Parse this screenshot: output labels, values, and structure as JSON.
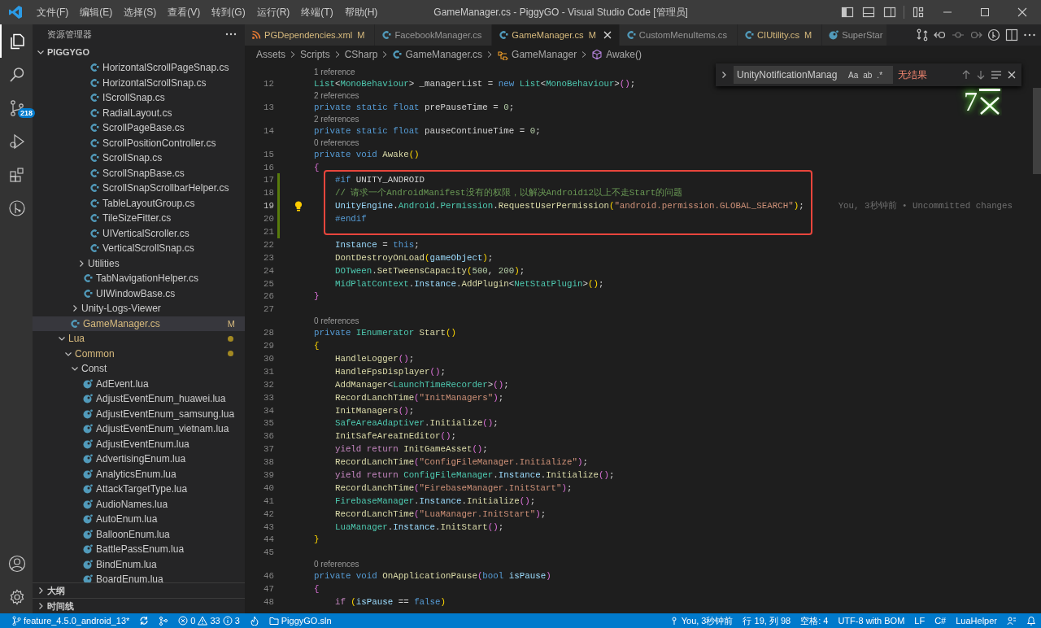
{
  "title_bar": {
    "menus": [
      "文件(F)",
      "编辑(E)",
      "选择(S)",
      "查看(V)",
      "转到(G)",
      "运行(R)",
      "终端(T)",
      "帮助(H)"
    ],
    "title": "GameManager.cs - PiggyGO - Visual Studio Code [管理员]"
  },
  "activity_bar": {
    "items": [
      {
        "kind": "files",
        "selected": true
      },
      {
        "kind": "search",
        "selected": false
      },
      {
        "kind": "scm",
        "selected": false,
        "badge": "218"
      },
      {
        "kind": "debug",
        "selected": false
      },
      {
        "kind": "extensions",
        "selected": false
      },
      {
        "kind": "graph",
        "selected": false
      }
    ],
    "bottom": [
      {
        "kind": "account"
      },
      {
        "kind": "settings"
      }
    ]
  },
  "sidebar": {
    "title": "资源管理器",
    "root": {
      "label": "PIGGYGO",
      "expanded": true
    },
    "items": [
      {
        "children": [
          {
            "children": [
              {
                "children": [
                  {
                    "children": [
                      {
                        "label": "HorizontalScrollPageSnap.cs",
                        "kind": "cs",
                        "selected": false,
                        "modified": false
                      },
                      {
                        "label": "HorizontalScrollSnap.cs",
                        "kind": "cs",
                        "selected": false,
                        "modified": false
                      },
                      {
                        "label": "IScrollSnap.cs",
                        "kind": "cs",
                        "selected": false,
                        "modified": false
                      },
                      {
                        "label": "RadialLayout.cs",
                        "kind": "cs",
                        "selected": false,
                        "modified": false
                      },
                      {
                        "label": "ScrollPageBase.cs",
                        "kind": "cs",
                        "selected": false,
                        "modified": false
                      },
                      {
                        "label": "ScrollPositionController.cs",
                        "kind": "cs",
                        "selected": false,
                        "modified": false
                      },
                      {
                        "label": "ScrollSnap.cs",
                        "kind": "cs",
                        "selected": false,
                        "modified": false
                      },
                      {
                        "label": "ScrollSnapBase.cs",
                        "kind": "cs",
                        "selected": false,
                        "modified": false
                      },
                      {
                        "label": "ScrollSnapScrollbarHelper.cs",
                        "kind": "cs",
                        "selected": false,
                        "modified": false
                      },
                      {
                        "label": "TableLayoutGroup.cs",
                        "kind": "cs",
                        "selected": false,
                        "modified": false
                      },
                      {
                        "label": "TileSizeFitter.cs",
                        "kind": "cs",
                        "selected": false,
                        "modified": false
                      },
                      {
                        "label": "UIVerticalScroller.cs",
                        "kind": "cs",
                        "selected": false,
                        "modified": false
                      },
                      {
                        "label": "VerticalScrollSnap.cs",
                        "kind": "cs",
                        "selected": false,
                        "modified": false
                      }
                    ]
                  },
                  {
                    "label": "Utilities",
                    "kind": "folder",
                    "expanded": false,
                    "selected": false,
                    "modified": false
                  },
                  {
                    "label": "TabNavigationHelper.cs",
                    "kind": "cs",
                    "selected": false,
                    "modified": false
                  },
                  {
                    "label": "UIWindowBase.cs",
                    "kind": "cs",
                    "selected": false,
                    "modified": false
                  }
                ]
              },
              {
                "label": "Unity-Logs-Viewer",
                "kind": "folder",
                "expanded": false,
                "selected": false,
                "modified": false
              }
            ]
          },
          {
            "label": "GameManager.cs",
            "kind": "cs",
            "selected": true,
            "modified": true,
            "badge": "M"
          }
        ]
      },
      {
        "label": "Lua",
        "kind": "folder",
        "expanded": true,
        "selected": false,
        "modified": true,
        "children": [
          {
            "label": "Common",
            "kind": "folder",
            "expanded": true,
            "selected": false,
            "modified": true,
            "children": [
              {
                "label": "Const",
                "kind": "folder",
                "expanded": true,
                "selected": false,
                "modified": false,
                "children": [
                  {
                    "label": "AdEvent.lua",
                    "kind": "lua",
                    "selected": false,
                    "modified": false
                  },
                  {
                    "label": "AdjustEventEnum_huawei.lua",
                    "kind": "lua",
                    "selected": false,
                    "modified": false
                  },
                  {
                    "label": "AdjustEventEnum_samsung.lua",
                    "kind": "lua",
                    "selected": false,
                    "modified": false
                  },
                  {
                    "label": "AdjustEventEnum_vietnam.lua",
                    "kind": "lua",
                    "selected": false,
                    "modified": false
                  },
                  {
                    "label": "AdjustEventEnum.lua",
                    "kind": "lua",
                    "selected": false,
                    "modified": false
                  },
                  {
                    "label": "AdvertisingEnum.lua",
                    "kind": "lua",
                    "selected": false,
                    "modified": false
                  },
                  {
                    "label": "AnalyticsEnum.lua",
                    "kind": "lua",
                    "selected": false,
                    "modified": false
                  },
                  {
                    "label": "AttackTargetType.lua",
                    "kind": "lua",
                    "selected": false,
                    "modified": false
                  },
                  {
                    "label": "AudioNames.lua",
                    "kind": "lua",
                    "selected": false,
                    "modified": false
                  },
                  {
                    "label": "AutoEnum.lua",
                    "kind": "lua",
                    "selected": false,
                    "modified": false
                  },
                  {
                    "label": "BalloonEnum.lua",
                    "kind": "lua",
                    "selected": false,
                    "modified": false
                  },
                  {
                    "label": "BattlePassEnum.lua",
                    "kind": "lua",
                    "selected": false,
                    "modified": false
                  },
                  {
                    "label": "BindEnum.lua",
                    "kind": "lua",
                    "selected": false,
                    "modified": false
                  },
                  {
                    "label": "BoardEnum.lua",
                    "kind": "lua",
                    "selected": false,
                    "modified": false
                  }
                ]
              }
            ]
          }
        ]
      }
    ],
    "sections": [
      {
        "label": "大纲",
        "expanded": false
      },
      {
        "label": "时间线",
        "expanded": false
      }
    ]
  },
  "tabs": [
    {
      "label": "PGDependencies.xml",
      "kind": "xml",
      "modified": true,
      "badge": "M",
      "selected": false
    },
    {
      "label": "FacebookManager.cs",
      "kind": "cs",
      "modified": false,
      "selected": false
    },
    {
      "label": "GameManager.cs",
      "kind": "cs",
      "modified": true,
      "badge": "M",
      "selected": true
    },
    {
      "label": "CustomMenuItems.cs",
      "kind": "cs",
      "modified": false,
      "selected": false
    },
    {
      "label": "CIUtility.cs",
      "kind": "cs",
      "modified": true,
      "badge": "M",
      "selected": false
    },
    {
      "label": "SuperStar",
      "kind": "lua",
      "modified": false,
      "selected": false
    }
  ],
  "breadcrumbs": [
    {
      "label": "Assets",
      "kind": "folder"
    },
    {
      "label": "Scripts",
      "kind": "folder"
    },
    {
      "label": "CSharp",
      "kind": "folder"
    },
    {
      "label": "GameManager.cs",
      "kind": "cs"
    },
    {
      "label": "GameManager",
      "kind": "class"
    },
    {
      "label": "Awake()",
      "kind": "method"
    }
  ],
  "find": {
    "value": "UnityNotificationManag",
    "options": [
      {
        "label": "Aa",
        "on": false
      },
      {
        "label": "ab",
        "on": false
      },
      {
        "label": ".*",
        "on": false
      }
    ],
    "result": "无结果"
  },
  "overlay": {
    "text": "7"
  },
  "code": {
    "lines": [
      {
        "n": "12",
        "ref": "1 reference",
        "changed": false,
        "boxed": false,
        "t": [
          {
            "kind": "ty",
            "text": "List"
          },
          {
            "kind": "pu",
            "text": "<"
          },
          {
            "kind": "ty",
            "text": "MonoBehaviour"
          },
          {
            "kind": "pu",
            "text": "> _managerList = "
          },
          {
            "kind": "kw",
            "text": "new "
          },
          {
            "kind": "ty",
            "text": "List"
          },
          {
            "kind": "pu",
            "text": "<"
          },
          {
            "kind": "ty",
            "text": "MonoBehaviour"
          },
          {
            "kind": "pu",
            "text": ">"
          },
          {
            "kind": "b2",
            "text": "()"
          },
          {
            "kind": "pu",
            "text": ";"
          }
        ]
      },
      {
        "n": "13",
        "ref": "2 references",
        "changed": false,
        "boxed": false,
        "t": [
          {
            "kind": "kw",
            "text": "private static float"
          },
          {
            "kind": "pu",
            "text": " prePauseTime = "
          },
          {
            "kind": "nu",
            "text": "0"
          },
          {
            "kind": "pu",
            "text": ";"
          }
        ]
      },
      {
        "n": "14",
        "ref": "2 references",
        "changed": false,
        "boxed": false,
        "t": [
          {
            "kind": "kw",
            "text": "private static float"
          },
          {
            "kind": "pu",
            "text": " pauseContinueTime = "
          },
          {
            "kind": "nu",
            "text": "0"
          },
          {
            "kind": "pu",
            "text": ";"
          }
        ]
      },
      {
        "n": "15",
        "ref": "0 references",
        "changed": false,
        "boxed": false,
        "t": [
          {
            "kind": "kw",
            "text": "private void "
          },
          {
            "kind": "fn",
            "text": "Awake"
          },
          {
            "kind": "b1",
            "text": "()"
          }
        ]
      },
      {
        "n": "16",
        "changed": false,
        "boxed": false,
        "t": [
          {
            "kind": "b2",
            "text": "{"
          }
        ]
      },
      {
        "n": "17",
        "changed": true,
        "boxed": true,
        "t": [
          {
            "kind": "kw",
            "text": "    #if"
          },
          {
            "kind": "pu",
            "text": " UNITY_ANDROID"
          }
        ]
      },
      {
        "n": "18",
        "changed": true,
        "boxed": true,
        "t": [
          {
            "kind": "cm",
            "text": "    // 请求一个AndroidManifest没有的权限，以解决Android12以上不走Start的问题"
          }
        ]
      },
      {
        "n": "19",
        "changed": true,
        "boxed": true,
        "lightbulb": true,
        "blame": "You, 3秒钟前 • Uncommitted changes",
        "t": [
          {
            "kind": "va",
            "text": "    UnityEngine"
          },
          {
            "kind": "pu",
            "text": "."
          },
          {
            "kind": "ty",
            "text": "Android"
          },
          {
            "kind": "pu",
            "text": "."
          },
          {
            "kind": "ty",
            "text": "Permission"
          },
          {
            "kind": "pu",
            "text": "."
          },
          {
            "kind": "fn",
            "text": "RequestUserPermission"
          },
          {
            "kind": "b1",
            "text": "("
          },
          {
            "kind": "st",
            "text": "\"android.permission.GLOBAL_SEARCH\""
          },
          {
            "kind": "b1",
            "text": ")"
          },
          {
            "kind": "pu",
            "text": ";"
          }
        ]
      },
      {
        "n": "20",
        "changed": true,
        "boxed": true,
        "t": [
          {
            "kind": "kw",
            "text": "    #endif"
          }
        ]
      },
      {
        "n": "21",
        "changed": true,
        "boxed": false
      },
      {
        "n": "22",
        "changed": false,
        "boxed": false,
        "t": [
          {
            "kind": "va",
            "text": "    Instance"
          },
          {
            "kind": "pu",
            "text": " = "
          },
          {
            "kind": "kw",
            "text": "this"
          },
          {
            "kind": "pu",
            "text": ";"
          }
        ]
      },
      {
        "n": "23",
        "changed": false,
        "boxed": false,
        "t": [
          {
            "kind": "fn",
            "text": "    DontDestroyOnLoad"
          },
          {
            "kind": "b1",
            "text": "("
          },
          {
            "kind": "va",
            "text": "gameObject"
          },
          {
            "kind": "b1",
            "text": ")"
          },
          {
            "kind": "pu",
            "text": ";"
          }
        ]
      },
      {
        "n": "24",
        "changed": false,
        "boxed": false,
        "t": [
          {
            "kind": "ty",
            "text": "    DOTween"
          },
          {
            "kind": "pu",
            "text": "."
          },
          {
            "kind": "fn",
            "text": "SetTweensCapacity"
          },
          {
            "kind": "b1",
            "text": "("
          },
          {
            "kind": "nu",
            "text": "500"
          },
          {
            "kind": "pu",
            "text": ", "
          },
          {
            "kind": "nu",
            "text": "200"
          },
          {
            "kind": "b1",
            "text": ")"
          },
          {
            "kind": "pu",
            "text": ";"
          }
        ]
      },
      {
        "n": "25",
        "changed": false,
        "boxed": false,
        "t": [
          {
            "kind": "ty",
            "text": "    MidPlatContext"
          },
          {
            "kind": "pu",
            "text": "."
          },
          {
            "kind": "va",
            "text": "Instance"
          },
          {
            "kind": "pu",
            "text": "."
          },
          {
            "kind": "fn",
            "text": "AddPlugin"
          },
          {
            "kind": "pu",
            "text": "<"
          },
          {
            "kind": "ty",
            "text": "NetStatPlugin"
          },
          {
            "kind": "pu",
            "text": ">"
          },
          {
            "kind": "b1",
            "text": "()"
          },
          {
            "kind": "pu",
            "text": ";"
          }
        ]
      },
      {
        "n": "26",
        "changed": false,
        "boxed": false,
        "t": [
          {
            "kind": "b2",
            "text": "}"
          }
        ]
      },
      {
        "n": "27",
        "changed": false,
        "boxed": false
      },
      {
        "n": "28",
        "ref": "0 references",
        "changed": false,
        "boxed": false,
        "t": [
          {
            "kind": "kw",
            "text": "private "
          },
          {
            "kind": "ty",
            "text": "IEnumerator "
          },
          {
            "kind": "fn",
            "text": "Start"
          },
          {
            "kind": "b1",
            "text": "()"
          }
        ]
      },
      {
        "n": "29",
        "changed": false,
        "boxed": false,
        "t": [
          {
            "kind": "b1",
            "text": "{"
          }
        ]
      },
      {
        "n": "30",
        "changed": false,
        "boxed": false,
        "t": [
          {
            "kind": "fn",
            "text": "    HandleLogger"
          },
          {
            "kind": "b2",
            "text": "()"
          },
          {
            "kind": "pu",
            "text": ";"
          }
        ]
      },
      {
        "n": "31",
        "changed": false,
        "boxed": false,
        "t": [
          {
            "kind": "fn",
            "text": "    HandleFpsDisplayer"
          },
          {
            "kind": "b2",
            "text": "()"
          },
          {
            "kind": "pu",
            "text": ";"
          }
        ]
      },
      {
        "n": "32",
        "changed": false,
        "boxed": false,
        "t": [
          {
            "kind": "fn",
            "text": "    AddManager"
          },
          {
            "kind": "pu",
            "text": "<"
          },
          {
            "kind": "ty",
            "text": "LaunchTimeRecorder"
          },
          {
            "kind": "pu",
            "text": ">"
          },
          {
            "kind": "b2",
            "text": "()"
          },
          {
            "kind": "pu",
            "text": ";"
          }
        ]
      },
      {
        "n": "33",
        "changed": false,
        "boxed": false,
        "t": [
          {
            "kind": "fn",
            "text": "    RecordLanchTime"
          },
          {
            "kind": "b2",
            "text": "("
          },
          {
            "kind": "st",
            "text": "\"InitManagers\""
          },
          {
            "kind": "b2",
            "text": ")"
          },
          {
            "kind": "pu",
            "text": ";"
          }
        ]
      },
      {
        "n": "34",
        "changed": false,
        "boxed": false,
        "t": [
          {
            "kind": "fn",
            "text": "    InitManagers"
          },
          {
            "kind": "b2",
            "text": "()"
          },
          {
            "kind": "pu",
            "text": ";"
          }
        ]
      },
      {
        "n": "35",
        "changed": false,
        "boxed": false,
        "t": [
          {
            "kind": "ty",
            "text": "    SafeAreaAdaptiver"
          },
          {
            "kind": "pu",
            "text": "."
          },
          {
            "kind": "fn",
            "text": "Initialize"
          },
          {
            "kind": "b2",
            "text": "()"
          },
          {
            "kind": "pu",
            "text": ";"
          }
        ]
      },
      {
        "n": "36",
        "changed": false,
        "boxed": false,
        "t": [
          {
            "kind": "fn",
            "text": "    InitSafeAreaInEditor"
          },
          {
            "kind": "b2",
            "text": "()"
          },
          {
            "kind": "pu",
            "text": ";"
          }
        ]
      },
      {
        "n": "37",
        "changed": false,
        "boxed": false,
        "t": [
          {
            "kind": "ctl",
            "text": "    yield return "
          },
          {
            "kind": "fn",
            "text": "InitGameAsset"
          },
          {
            "kind": "b2",
            "text": "()"
          },
          {
            "kind": "pu",
            "text": ";"
          }
        ]
      },
      {
        "n": "38",
        "changed": false,
        "boxed": false,
        "t": [
          {
            "kind": "fn",
            "text": "    RecordLanchTime"
          },
          {
            "kind": "b2",
            "text": "("
          },
          {
            "kind": "st",
            "text": "\"ConfigFileManager.Initialize\""
          },
          {
            "kind": "b2",
            "text": ")"
          },
          {
            "kind": "pu",
            "text": ";"
          }
        ]
      },
      {
        "n": "39",
        "changed": false,
        "boxed": false,
        "t": [
          {
            "kind": "ctl",
            "text": "    yield return "
          },
          {
            "kind": "ty",
            "text": "ConfigFileManager"
          },
          {
            "kind": "pu",
            "text": "."
          },
          {
            "kind": "va",
            "text": "Instance"
          },
          {
            "kind": "pu",
            "text": "."
          },
          {
            "kind": "fn",
            "text": "Initialize"
          },
          {
            "kind": "b2",
            "text": "()"
          },
          {
            "kind": "pu",
            "text": ";"
          }
        ]
      },
      {
        "n": "40",
        "changed": false,
        "boxed": false,
        "t": [
          {
            "kind": "fn",
            "text": "    RecordLanchTime"
          },
          {
            "kind": "b2",
            "text": "("
          },
          {
            "kind": "st",
            "text": "\"FirebaseManager.InitStart\""
          },
          {
            "kind": "b2",
            "text": ")"
          },
          {
            "kind": "pu",
            "text": ";"
          }
        ]
      },
      {
        "n": "41",
        "changed": false,
        "boxed": false,
        "t": [
          {
            "kind": "ty",
            "text": "    FirebaseManager"
          },
          {
            "kind": "pu",
            "text": "."
          },
          {
            "kind": "va",
            "text": "Instance"
          },
          {
            "kind": "pu",
            "text": "."
          },
          {
            "kind": "fn",
            "text": "Initialize"
          },
          {
            "kind": "b2",
            "text": "()"
          },
          {
            "kind": "pu",
            "text": ";"
          }
        ]
      },
      {
        "n": "42",
        "changed": false,
        "boxed": false,
        "t": [
          {
            "kind": "fn",
            "text": "    RecordLanchTime"
          },
          {
            "kind": "b2",
            "text": "("
          },
          {
            "kind": "st",
            "text": "\"LuaManager.InitStart\""
          },
          {
            "kind": "b2",
            "text": ")"
          },
          {
            "kind": "pu",
            "text": ";"
          }
        ]
      },
      {
        "n": "43",
        "changed": false,
        "boxed": false,
        "t": [
          {
            "kind": "ty",
            "text": "    LuaManager"
          },
          {
            "kind": "pu",
            "text": "."
          },
          {
            "kind": "va",
            "text": "Instance"
          },
          {
            "kind": "pu",
            "text": "."
          },
          {
            "kind": "fn",
            "text": "InitStart"
          },
          {
            "kind": "b2",
            "text": "()"
          },
          {
            "kind": "pu",
            "text": ";"
          }
        ]
      },
      {
        "n": "44",
        "changed": false,
        "boxed": false,
        "t": [
          {
            "kind": "b1",
            "text": "}"
          }
        ]
      },
      {
        "n": "45",
        "changed": false,
        "boxed": false
      },
      {
        "n": "46",
        "ref": "0 references",
        "changed": false,
        "boxed": false,
        "t": [
          {
            "kind": "kw",
            "text": "private void "
          },
          {
            "kind": "fn",
            "text": "OnApplicationPause"
          },
          {
            "kind": "b2",
            "text": "("
          },
          {
            "kind": "kw",
            "text": "bool "
          },
          {
            "kind": "va",
            "text": "isPause"
          },
          {
            "kind": "b2",
            "text": ")"
          }
        ]
      },
      {
        "n": "47",
        "changed": false,
        "boxed": false,
        "t": [
          {
            "kind": "b2",
            "text": "{"
          }
        ]
      },
      {
        "n": "48",
        "changed": false,
        "boxed": false,
        "t": [
          {
            "kind": "ctl",
            "text": "    if "
          },
          {
            "kind": "b1",
            "text": "("
          },
          {
            "kind": "va",
            "text": "isPause"
          },
          {
            "kind": "pu",
            "text": " == "
          },
          {
            "kind": "kw",
            "text": "false"
          },
          {
            "kind": "b1",
            "text": ")"
          }
        ]
      }
    ]
  },
  "status_bar": {
    "left": [
      {
        "kind": "branch",
        "text": "feature_4.5.0_android_13*"
      },
      {
        "kind": "sync"
      },
      {
        "kind": "graph"
      },
      {
        "kind": "problems",
        "errors": "0",
        "warnings": "33",
        "infos": "3"
      },
      {
        "kind": "flame"
      },
      {
        "kind": "solution",
        "text": "PiggyGO.sln"
      }
    ],
    "right": [
      {
        "kind": "blame",
        "text": "You, 3秒钟前"
      },
      {
        "kind": "text",
        "text": "行 19, 列 98"
      },
      {
        "kind": "text",
        "text": "空格: 4"
      },
      {
        "kind": "text",
        "text": "UTF-8 with BOM"
      },
      {
        "kind": "text",
        "text": "LF"
      },
      {
        "kind": "text",
        "text": "C#"
      },
      {
        "kind": "text",
        "text": "LuaHelper"
      },
      {
        "kind": "feedback"
      },
      {
        "kind": "bell"
      }
    ]
  }
}
